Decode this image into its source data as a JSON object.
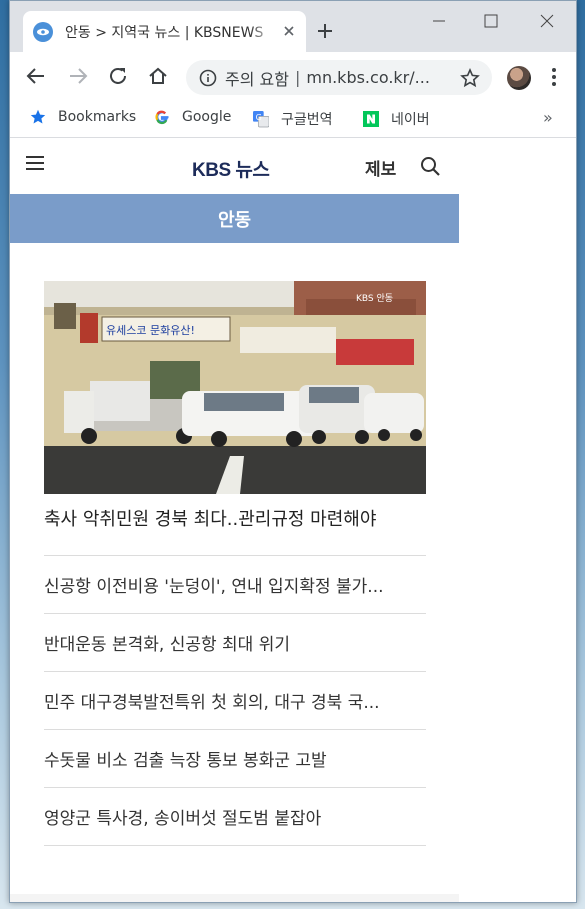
{
  "browser": {
    "tab": {
      "title": "안동 > 지역국 뉴스 | KBSNEWS"
    },
    "address": {
      "security_label": "주의 요함",
      "separator": "|",
      "url": "mn.kbs.co.kr/..."
    }
  },
  "bookmarks": {
    "items": [
      {
        "label": "Bookmarks",
        "icon": "star-icon"
      },
      {
        "label": "Google",
        "icon": "google-icon"
      },
      {
        "label": "구글번역",
        "icon": "translate-icon"
      },
      {
        "label": "네이버",
        "icon": "naver-icon"
      }
    ],
    "more": "»"
  },
  "site": {
    "logo": "KBS 뉴스",
    "report_label": "제보",
    "region": "안동"
  },
  "photo": {
    "signs": [
      "유세스코 문화유산!",
      "KBS 안동"
    ]
  },
  "news": {
    "headline": "축사 악취민원 경북 최다..관리규정 마련해야",
    "items": [
      "신공항 이전비용 '눈덩이', 연내 입지확정 불가...",
      "반대운동 본격화, 신공항 최대 위기",
      "민주 대구경북발전특위 첫 회의, 대구 경북 국...",
      "수돗물 비소 검출 늑장 통보 봉화군 고발",
      "영양군 특사경, 송이버섯 절도범 붙잡아"
    ]
  },
  "colors": {
    "region_bar": "#7a9cc9",
    "logo": "#1d2c5a"
  }
}
